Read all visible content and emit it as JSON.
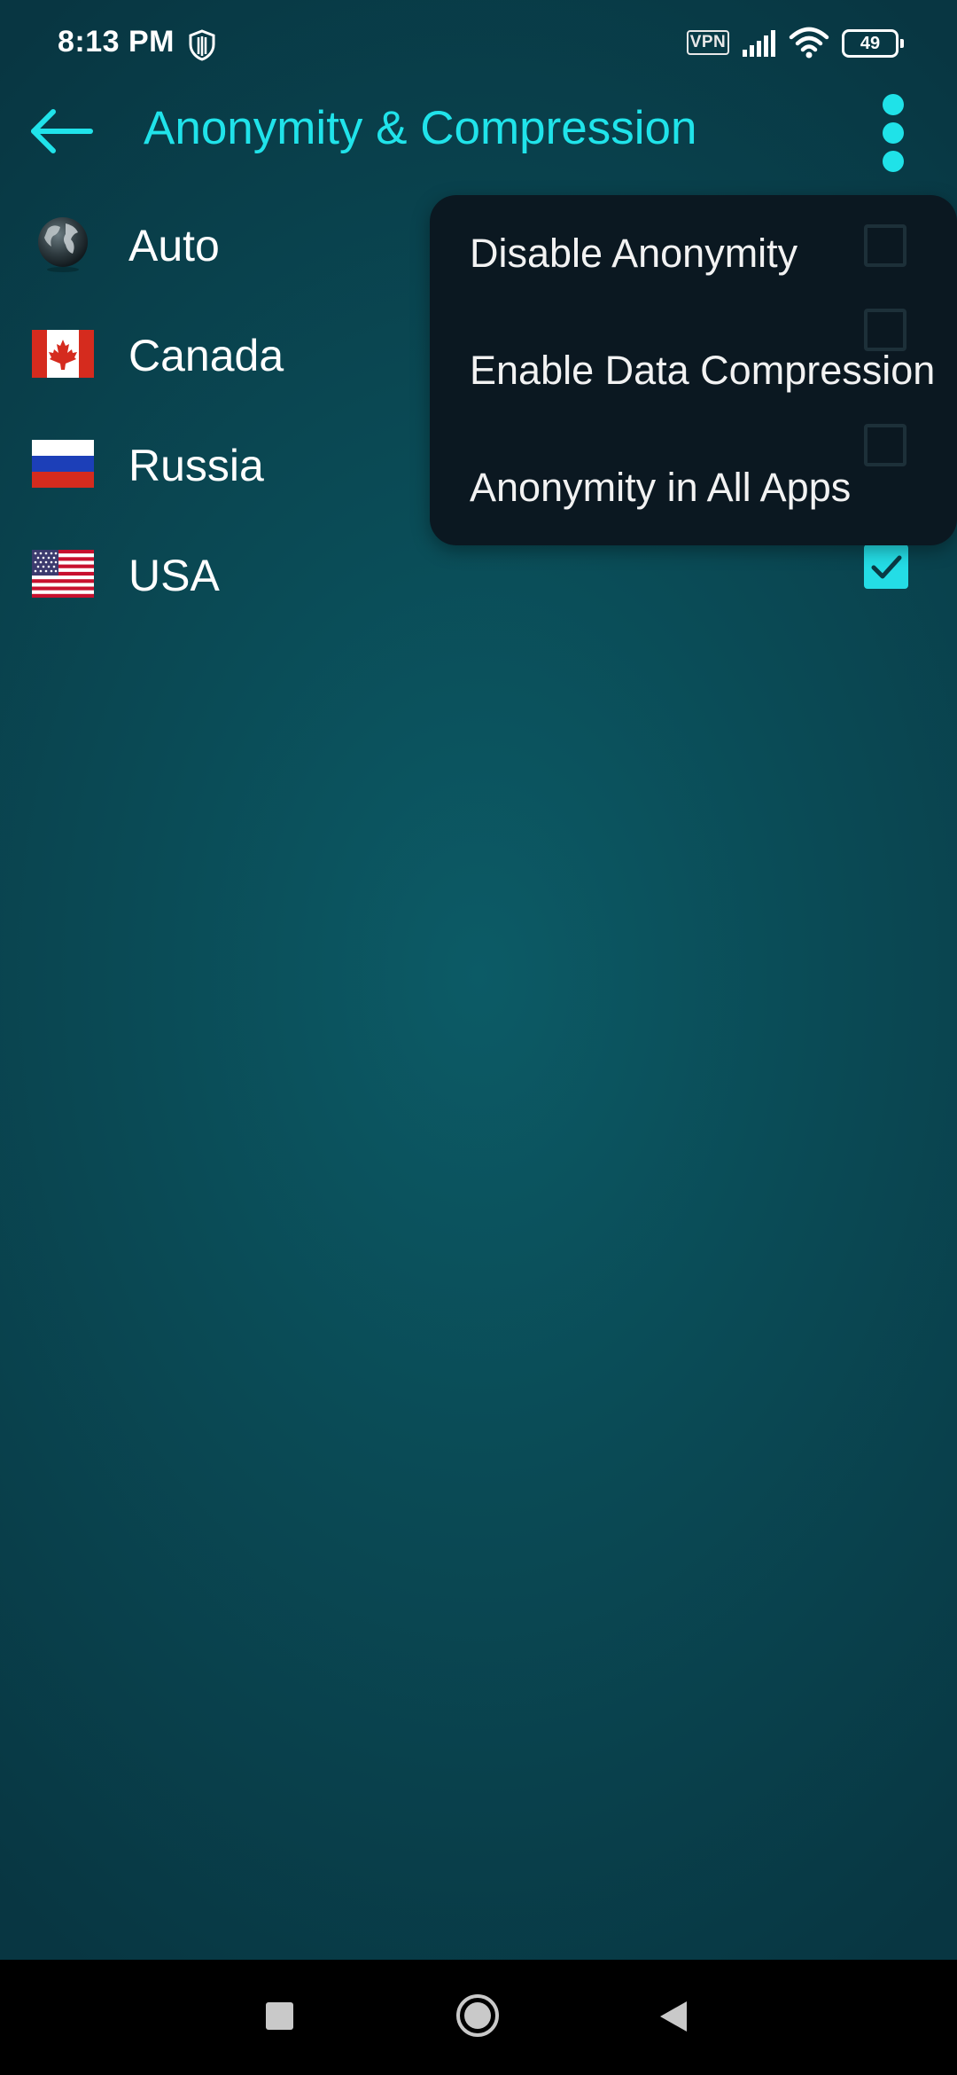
{
  "status_bar": {
    "time": "8:13 PM",
    "vpn_label": "VPN",
    "battery_level": "49",
    "icons": [
      "shield-icon",
      "vpn-icon",
      "signal-icon",
      "wifi-icon",
      "battery-icon"
    ]
  },
  "app_bar": {
    "title": "Anonymity & Compression",
    "back_icon": "arrow-left-icon",
    "menu_icon": "more-vertical-icon"
  },
  "countries": [
    {
      "label": "Auto",
      "flag": "globe-icon",
      "checked": false
    },
    {
      "label": "Canada",
      "flag": "canada-flag-icon",
      "checked": false
    },
    {
      "label": "Russia",
      "flag": "russia-flag-icon",
      "checked": false
    },
    {
      "label": "USA",
      "flag": "usa-flag-icon",
      "checked": true
    }
  ],
  "menu": {
    "items": [
      {
        "label": "Disable Anonymity",
        "checked": false
      },
      {
        "label": "Enable Data Compression",
        "checked": false
      },
      {
        "label": "Anonymity in All Apps",
        "checked": false
      }
    ]
  },
  "nav_bar": {
    "icons": [
      "recents-icon",
      "home-icon",
      "back-icon"
    ]
  },
  "colors": {
    "accent": "#20e3ea",
    "background": "#0a4a55",
    "menu_background": "#0b1821",
    "nav_background": "#000000"
  }
}
